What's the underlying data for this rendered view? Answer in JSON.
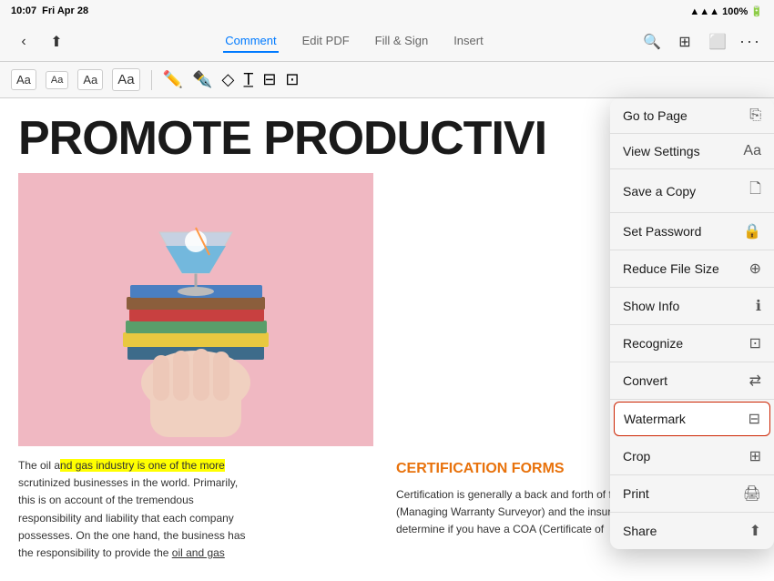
{
  "statusBar": {
    "time": "10:07",
    "day": "Fri Apr 28",
    "battery": "100%",
    "batteryIcon": "🔋",
    "wifiIcon": "wifi",
    "ellipsis": "···"
  },
  "toolbar": {
    "tabs": [
      {
        "label": "Comment",
        "active": true
      },
      {
        "label": "Edit PDF",
        "active": false
      },
      {
        "label": "Fill & Sign",
        "active": false
      },
      {
        "label": "Insert",
        "active": false
      }
    ],
    "moreLabel": "···"
  },
  "annotationBar": {
    "items": [
      {
        "label": "Aa",
        "size": "normal"
      },
      {
        "label": "Aa",
        "size": "small"
      },
      {
        "label": "Aa",
        "size": "medium"
      },
      {
        "label": "Aa",
        "size": "big"
      }
    ]
  },
  "pdfContent": {
    "title": "PROMOTE PRODUCTIVI",
    "textLeft": "The oil and gas industry is one of the more scrutinized businesses in the world. Primarily, this is on account of the tremendous responsibility and liability that each company possesses. On the one hand, the business has the responsibility to provide the oil and gas",
    "highlightedText": "nd gas industry is one of the more",
    "certificationTitle": "CERTIFICATION FORMS",
    "textRight": "Certification is generally a back and forth of fixes between the MWS (Managing Warranty Surveyor) and the insurer. Since the MWS will determine if you have a COA (Certificate of"
  },
  "dropdownMenu": {
    "items": [
      {
        "id": "go-to-page",
        "label": "Go to Page",
        "icon": "page",
        "selected": false
      },
      {
        "id": "view-settings",
        "label": "View Settings",
        "icon": "text-size",
        "selected": false
      },
      {
        "id": "save-copy",
        "label": "Save a Copy",
        "icon": "save",
        "selected": false
      },
      {
        "id": "set-password",
        "label": "Set Password",
        "icon": "lock",
        "selected": false
      },
      {
        "id": "reduce-file-size",
        "label": "Reduce File Size",
        "icon": "compress",
        "selected": false
      },
      {
        "id": "show-info",
        "label": "Show Info",
        "icon": "info",
        "selected": false
      },
      {
        "id": "recognize",
        "label": "Recognize",
        "icon": "ocr",
        "selected": false
      },
      {
        "id": "convert",
        "label": "Convert",
        "icon": "convert",
        "selected": false
      },
      {
        "id": "watermark",
        "label": "Watermark",
        "icon": "watermark",
        "selected": true
      },
      {
        "id": "crop",
        "label": "Crop",
        "icon": "crop",
        "selected": false
      },
      {
        "id": "print",
        "label": "Print",
        "icon": "print",
        "selected": false
      },
      {
        "id": "share",
        "label": "Share",
        "icon": "share",
        "selected": false
      }
    ]
  }
}
